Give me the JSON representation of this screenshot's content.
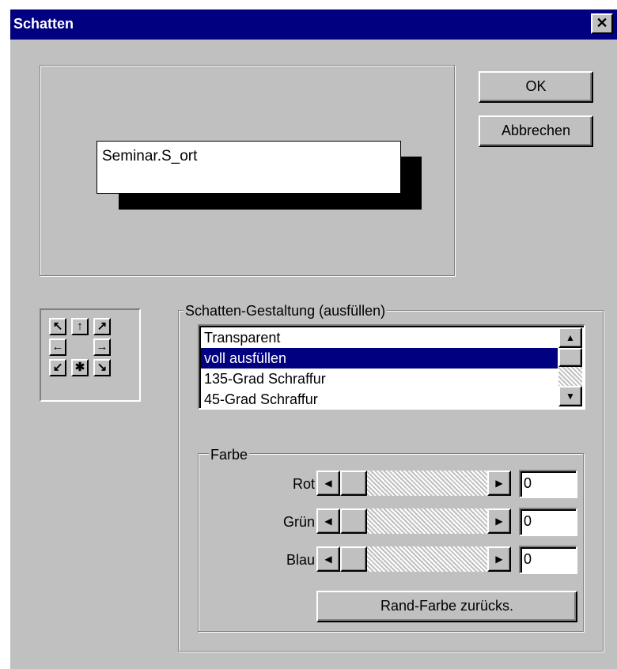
{
  "window": {
    "title": "Schatten",
    "close_glyph": "✕"
  },
  "buttons": {
    "ok_label": "OK",
    "cancel_label": "Abbrechen",
    "reset_color_label": "Rand-Farbe zurücks."
  },
  "preview": {
    "field_text": "Seminar.S_ort"
  },
  "direction_pad": {
    "up_left": "↖",
    "up": "↑",
    "up_right": "↗",
    "left": "←",
    "right": "→",
    "down_left": "↙",
    "center": "✱",
    "down_right": "↘"
  },
  "shadow_style": {
    "group_label": "Schatten-Gestaltung (ausfüllen)",
    "items": [
      {
        "label": "Transparent",
        "selected": false
      },
      {
        "label": "voll ausfüllen",
        "selected": true
      },
      {
        "label": "135-Grad Schraffur",
        "selected": false
      },
      {
        "label": "45-Grad Schraffur",
        "selected": false
      }
    ],
    "scroll_up_glyph": "▲",
    "scroll_down_glyph": "▼"
  },
  "color": {
    "group_label": "Farbe",
    "channels": [
      {
        "label": "Rot",
        "value": "0"
      },
      {
        "label": "Grün",
        "value": "0"
      },
      {
        "label": "Blau",
        "value": "0"
      }
    ],
    "left_glyph": "◀",
    "right_glyph": "▶"
  },
  "colors": {
    "titlebar": "#000080",
    "dialog_bg": "#c0c0c0",
    "selection": "#000080"
  }
}
